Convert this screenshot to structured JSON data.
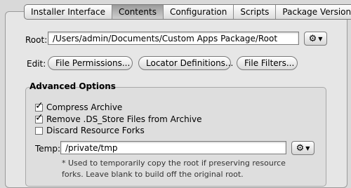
{
  "tabs": [
    {
      "label": "Installer Interface",
      "selected": false
    },
    {
      "label": "Contents",
      "selected": true
    },
    {
      "label": "Configuration",
      "selected": false
    },
    {
      "label": "Scripts",
      "selected": false
    },
    {
      "label": "Package Version",
      "selected": false
    }
  ],
  "root": {
    "label": "Root:",
    "value": "/Users/admin/Documents/Custom Apps Package/Root"
  },
  "edit": {
    "label": "Edit:",
    "buttons": [
      "File Permissions...",
      "Locator Definitions...",
      "File Filters..."
    ]
  },
  "advanced": {
    "title": "Advanced Options",
    "options": [
      {
        "label": "Compress Archive",
        "checked": true
      },
      {
        "label": "Remove .DS_Store Files from Archive",
        "checked": true
      },
      {
        "label": "Discard Resource Forks",
        "checked": false
      }
    ],
    "temp_label": "Temp:",
    "temp_value": "/private/tmp",
    "note": "* Used to temporarily copy the root if preserving resource forks.  Leave blank to build off the original root."
  },
  "icons": {
    "gear": "gear-icon",
    "dropdown": "chevron-down-icon"
  }
}
